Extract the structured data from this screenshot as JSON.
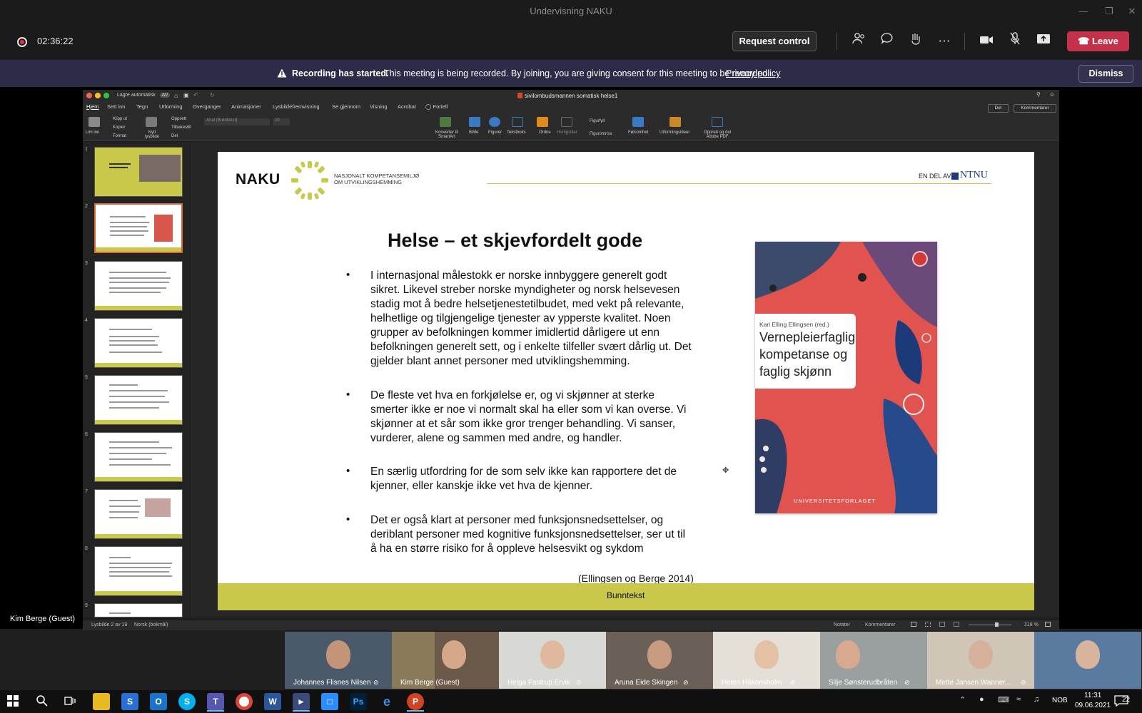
{
  "window": {
    "title": "Undervisning NAKU"
  },
  "meeting_bar": {
    "recording_time": "02:36:22",
    "request_control_label": "Request control",
    "leave_label": "Leave"
  },
  "banner": {
    "title": "Recording has started.",
    "message": "This meeting is being recorded. By joining, you are giving consent for this meeting to be recorded.",
    "link": "Privacy policy",
    "dismiss_label": "Dismiss"
  },
  "powerpoint": {
    "autosave_label": "Lagre automatisk",
    "autosave_state": "AV",
    "document_name": "sivilombudsmannen somatisk helse1",
    "tabs": [
      "Hjem",
      "Sett inn",
      "Tegn",
      "Utforming",
      "Overganger",
      "Animasjoner",
      "Lysbildefremvisning",
      "Se gjennom",
      "Visning",
      "Acrobat",
      "Fortell"
    ],
    "active_tab": "Hjem",
    "share_label": "Del",
    "comments_label": "Kommentarer",
    "ribbon": {
      "paste": "Lim inn",
      "cut": "Klipp ut",
      "copy": "Kopier",
      "format": "Format",
      "new_slide": "Nytt lysbilde",
      "layout": "Oppsett",
      "reset": "Tilbakestill",
      "section": "Del",
      "font_name": "Arial (Brødtekst)",
      "font_size": "20",
      "convert_smartart": "Konverter til SmartArt",
      "picture": "Bilde",
      "shapes": "Figurer",
      "textbox": "Tekstboks",
      "arrange": "Ordne",
      "quick_styles": "Hurtigstiler",
      "shape_fill": "Figurfyll",
      "shape_outline": "Figuromriss",
      "sensitivity": "Følsomhet",
      "design_ideas": "Utformingsideer",
      "create_pdf": "Opprett og del Adobe PDF"
    },
    "thumbnail_numbers": [
      "1",
      "2",
      "3",
      "4",
      "5",
      "6",
      "7",
      "8",
      "9"
    ],
    "status_left": "Lysbilde 2 av 19",
    "status_lang": "Norsk (bokmål)",
    "status_notes": "Notater",
    "status_comments": "Kommentarer",
    "zoom": "218 %"
  },
  "slide": {
    "logo": "NAKU",
    "logo_sub1": "NASJONALT KOMPETANSEMILJØ",
    "logo_sub2": "OM UTVIKLINGSHEMMING",
    "en_del_av": "EN DEL AV",
    "ntnu": "NTNU",
    "title": "Helse – et skjevfordelt gode",
    "bullets": [
      {
        "lines": [
          "I internasjonal målestokk er norske innbyggere generelt godt",
          "sikret. Likevel streber norske myndigheter og norsk helsevesen",
          "stadig mot å bedre helsetjenestetilbudet, med vekt på relevante,",
          "helhetlige og tilgjengelige tjenester av ypperste kvalitet. Noen",
          "grupper av befolkningen kommer imidlertid dårligere ut enn",
          "befolkningen generelt sett, og i enkelte tilfeller svært dårlig ut. Det",
          "gjelder blant annet personer med utviklingshemming."
        ]
      },
      {
        "lines": [
          "De fleste vet hva en forkjølelse er, og vi skjønner at sterke",
          "smerter ikke er noe vi normalt skal ha eller som vi kan overse. Vi",
          "skjønner at et sår som ikke gror trenger behandling. Vi sanser,",
          "vurderer, alene og sammen med andre, og handler."
        ]
      },
      {
        "lines": [
          "En særlig utfordring for de som selv ikke kan rapportere det de",
          "kjenner, eller kanskje ikke vet hva de kjenner."
        ]
      },
      {
        "lines": [
          "Det er også klart at personer med funksjonsnedsettelser, og",
          "deriblant personer med kognitive funksjonsnedsettelser, ser ut til",
          "å ha en større risiko for å oppleve helsesvikt og sykdom"
        ]
      }
    ],
    "citation": "(Ellingsen og Berge 2014)",
    "footer": "Bunntekst",
    "book": {
      "author": "Kari Elling Ellingsen (red.)",
      "title_lines": [
        "Vernepleierfaglig",
        "kompetanse og",
        "faglig skjønn"
      ],
      "publisher": "UNIVERSITETSFORLAGET"
    }
  },
  "presenter_label": "Kim Berge (Guest)",
  "participants": [
    "Johannes Flisnes Nilsen",
    "Kim Berge (Guest)",
    "Helga Fastrup Ervik",
    "Aruna Eide Skingen",
    "Helen Håkonsholm",
    "Silje Sønsterudbråten",
    "Mette Jansen Wanner..."
  ],
  "taskbar": {
    "lang": "NOB",
    "time": "11:31",
    "date": "09.06.2021",
    "notifications": "22"
  },
  "colors": {
    "banner": "#2c2b48",
    "leave": "#c4314b",
    "naku_yellow": "#c9c84a",
    "ntnu_blue": "#1f3a7a"
  }
}
